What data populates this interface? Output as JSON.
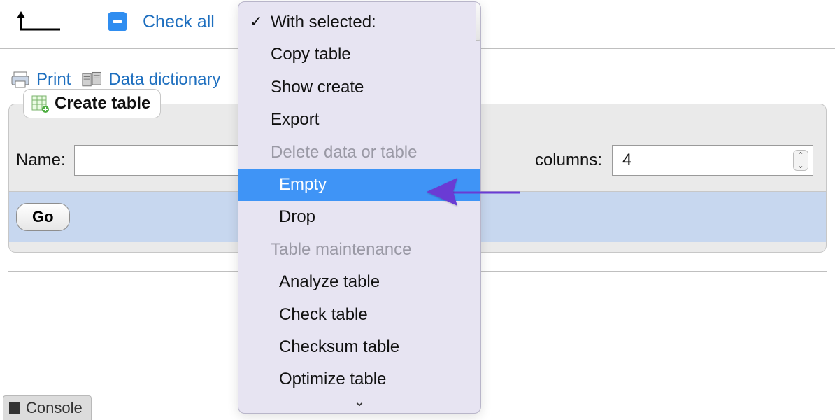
{
  "top": {
    "check_all": "Check all"
  },
  "links": {
    "print": "Print",
    "dictionary": "Data dictionary"
  },
  "create": {
    "legend": "Create table",
    "name_label": "Name:",
    "name_value": "",
    "cols_label_suffix": "columns:",
    "cols_value": "4",
    "go": "Go"
  },
  "console": {
    "label": "Console"
  },
  "dropdown": {
    "header": "With selected:",
    "items_top": [
      "Copy table",
      "Show create",
      "Export"
    ],
    "group_delete": "Delete data or table",
    "empty": "Empty",
    "drop": "Drop",
    "group_maint": "Table maintenance",
    "items_maint": [
      "Analyze table",
      "Check table",
      "Checksum table",
      "Optimize table"
    ]
  }
}
